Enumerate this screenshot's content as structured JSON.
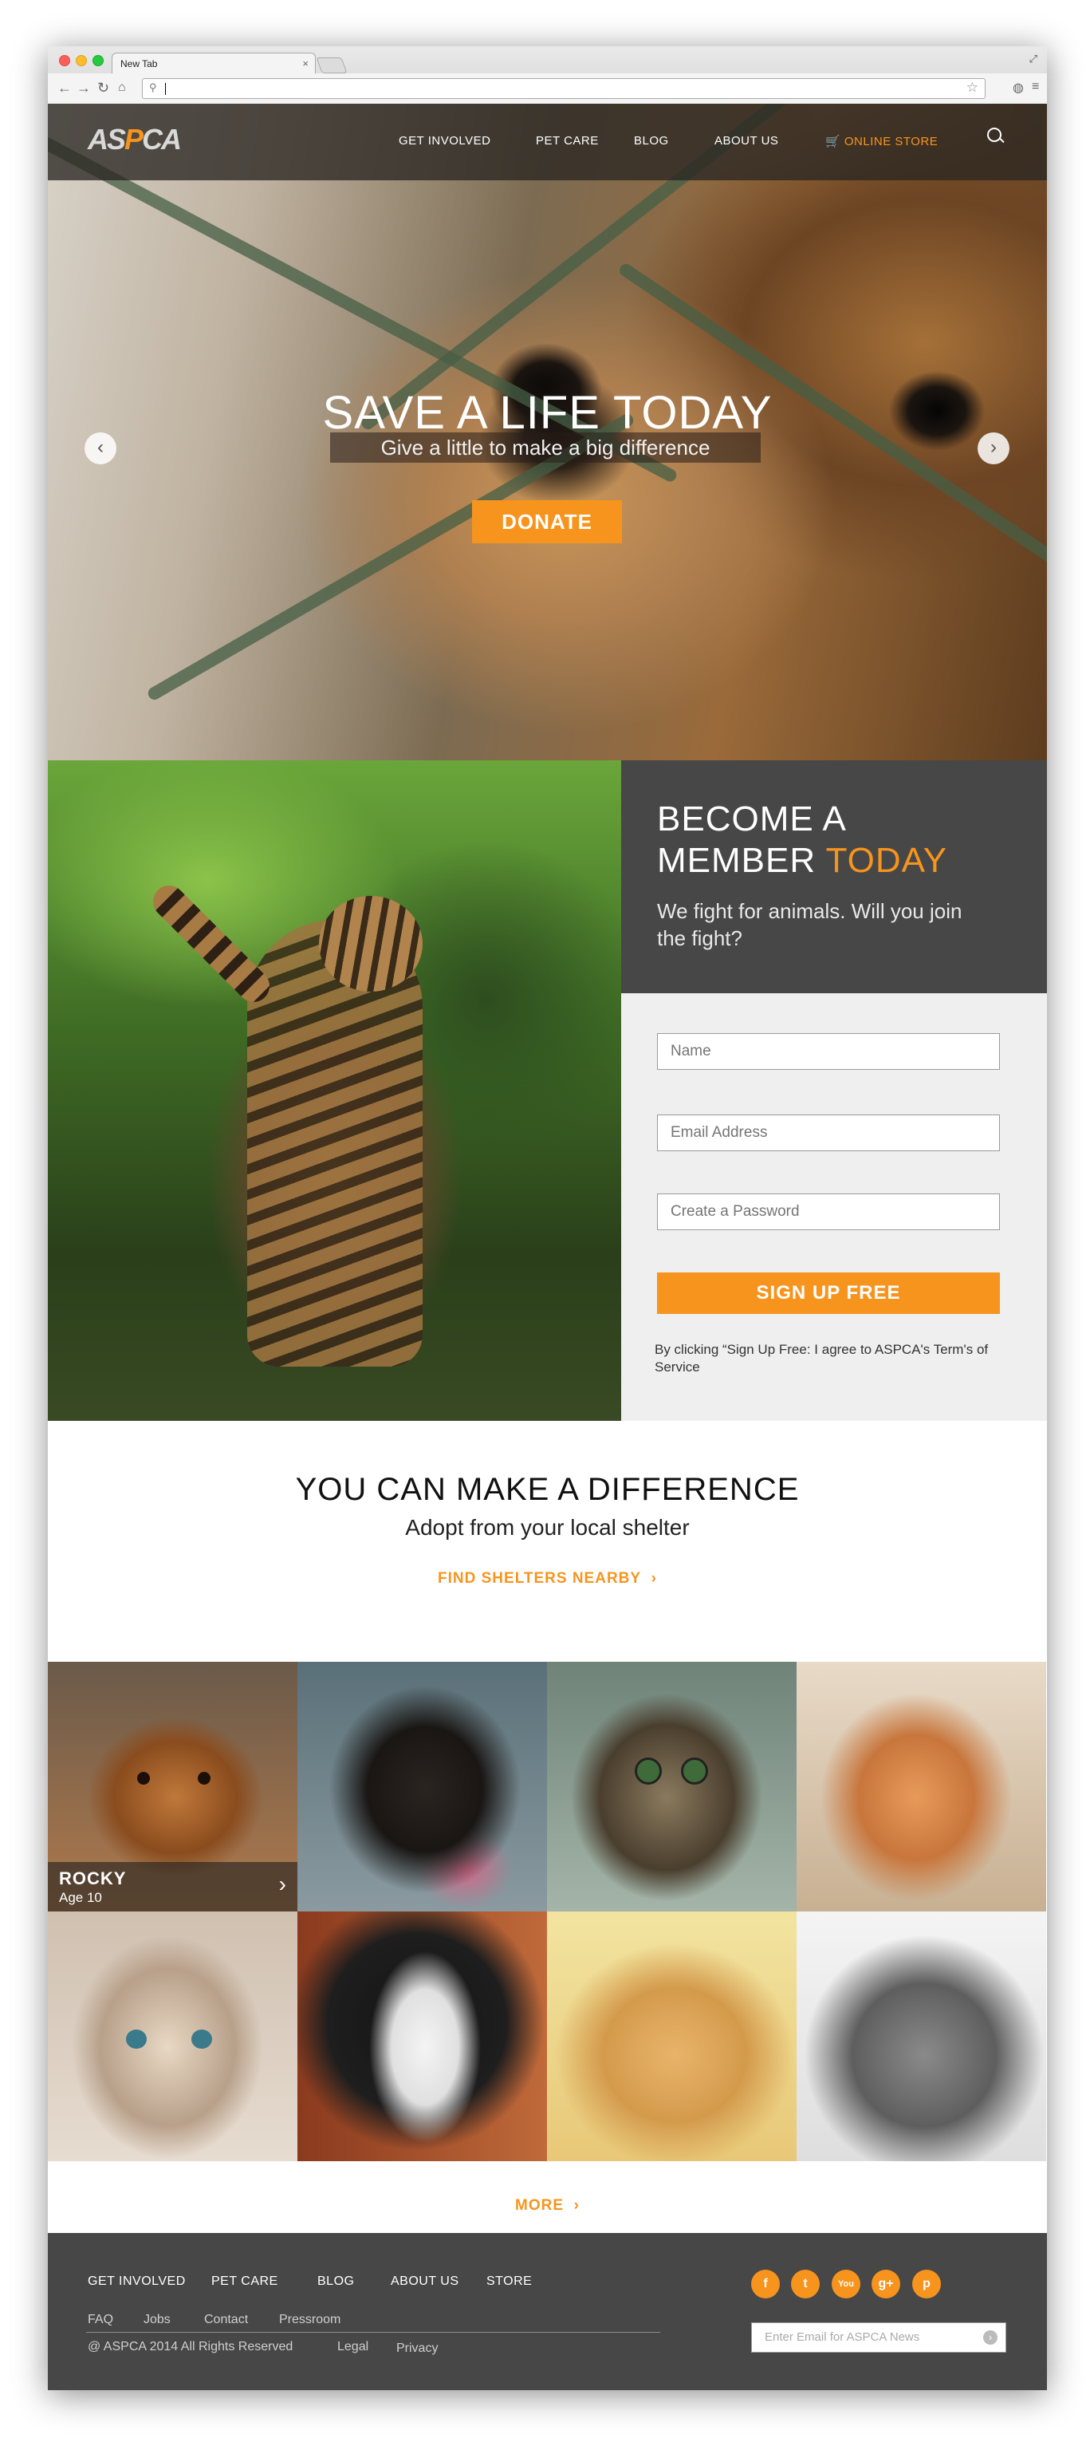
{
  "browser": {
    "tab_title": "New Tab",
    "tab_close": "×",
    "url": ""
  },
  "header": {
    "logo": {
      "left": "AS",
      "accent": "P",
      "right": "CA"
    },
    "nav": [
      "GET INVOLVED",
      "PET CARE",
      "BLOG",
      "ABOUT US"
    ],
    "store": "ONLINE STORE",
    "store_icon": "🛒"
  },
  "hero": {
    "title": "SAVE A LIFE TODAY",
    "subtitle": "Give a little to make a big difference",
    "cta": "DONATE",
    "prev": "‹",
    "next": "›"
  },
  "member": {
    "title_line1": "BECOME A",
    "title_line2": "MEMBER",
    "title_accent": "TODAY",
    "subtitle": "We fight for animals. Will you join the fight?",
    "name_placeholder": "Name",
    "email_placeholder": "Email Address",
    "password_placeholder": "Create a Password",
    "signup": "SIGN UP FREE",
    "terms": "By clicking “Sign Up Free: I agree to ASPCA's Term's of Service"
  },
  "difference": {
    "title": "YOU CAN MAKE A DIFFERENCE",
    "subtitle": "Adopt from your local shelter",
    "link": "FIND SHELTERS NEARBY",
    "link_arrow": "›"
  },
  "pets": {
    "featured": {
      "name": "ROCKY",
      "age": "Age 10",
      "arrow": "›"
    },
    "more": "MORE",
    "more_arrow": "›"
  },
  "footer": {
    "nav": [
      "GET INVOLVED",
      "PET CARE",
      "BLOG",
      "ABOUT US",
      "STORE"
    ],
    "links": [
      "FAQ",
      "Jobs",
      "Contact",
      "Pressroom"
    ],
    "copyright": "@ ASPCA 2014 All Rights Reserved",
    "legal": "Legal",
    "privacy": "Privacy",
    "social": [
      "f",
      "t",
      "You",
      "g+",
      "p"
    ],
    "newsletter_placeholder": "Enter Email for ASPCA News",
    "newsletter_go": "›"
  },
  "colors": {
    "accent": "#f7941d",
    "dark_panel": "#474747",
    "form_bg": "#efefef"
  }
}
